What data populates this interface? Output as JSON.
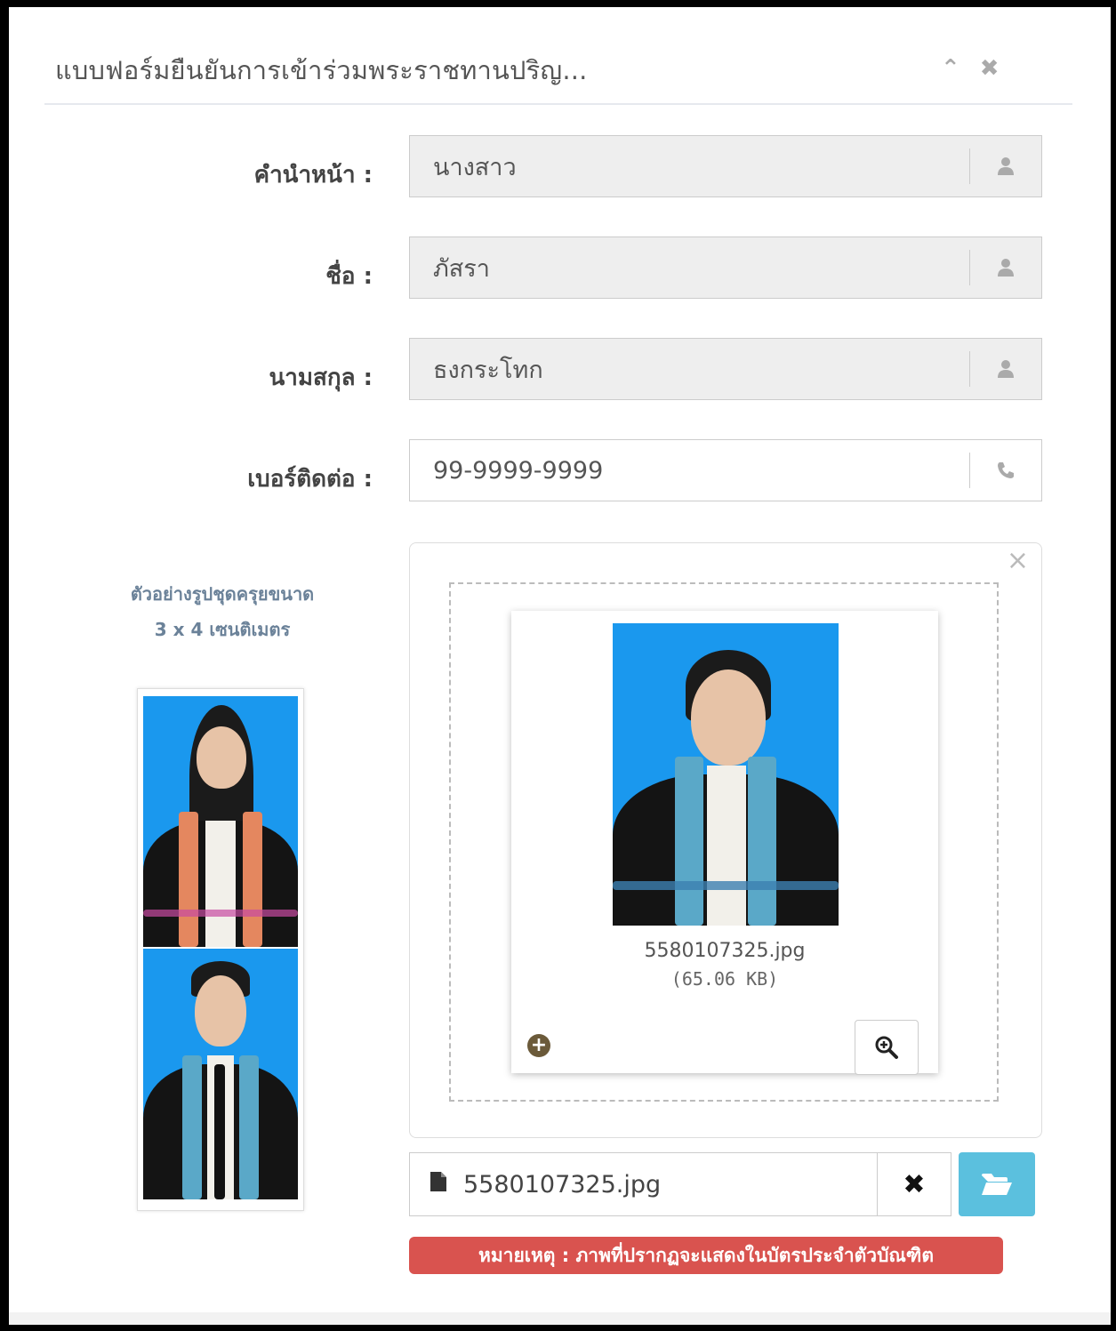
{
  "header": {
    "title": "แบบฟอร์มยืนยันการเข้าร่วมพระราชทานปริญ...",
    "collapse_icon": "chevron-up-icon",
    "close_icon": "close-icon"
  },
  "form": {
    "prefix": {
      "label": "คำนำหน้า :",
      "value": "นางสาว",
      "icon": "user-icon",
      "readonly": true
    },
    "first_name": {
      "label": "ชื่อ :",
      "value": "ภัสรา",
      "icon": "user-icon",
      "readonly": true
    },
    "last_name": {
      "label": "นามสกุล :",
      "value": "ธงกระโทก",
      "icon": "user-icon",
      "readonly": true
    },
    "phone": {
      "label": "เบอร์ติดต่อ :",
      "value": "99-9999-9999",
      "icon": "phone-icon",
      "readonly": false
    }
  },
  "sample": {
    "caption_line1": "ตัวอย่างรูปชุดครุยขนาด",
    "caption_line2": "3 x 4 เซนติเมตร"
  },
  "upload": {
    "preview_filename": "5580107325.jpg",
    "preview_size": "(65.06 KB)",
    "selected_filename": "5580107325.jpg"
  },
  "note": "หมายเหตุ : ภาพที่ปรากฏจะแสดงในบัตรประจำตัวบัณฑิต",
  "colors": {
    "photo_background": "#1a98ee",
    "browse_button": "#5bc0de",
    "note_background": "#d9534f"
  }
}
